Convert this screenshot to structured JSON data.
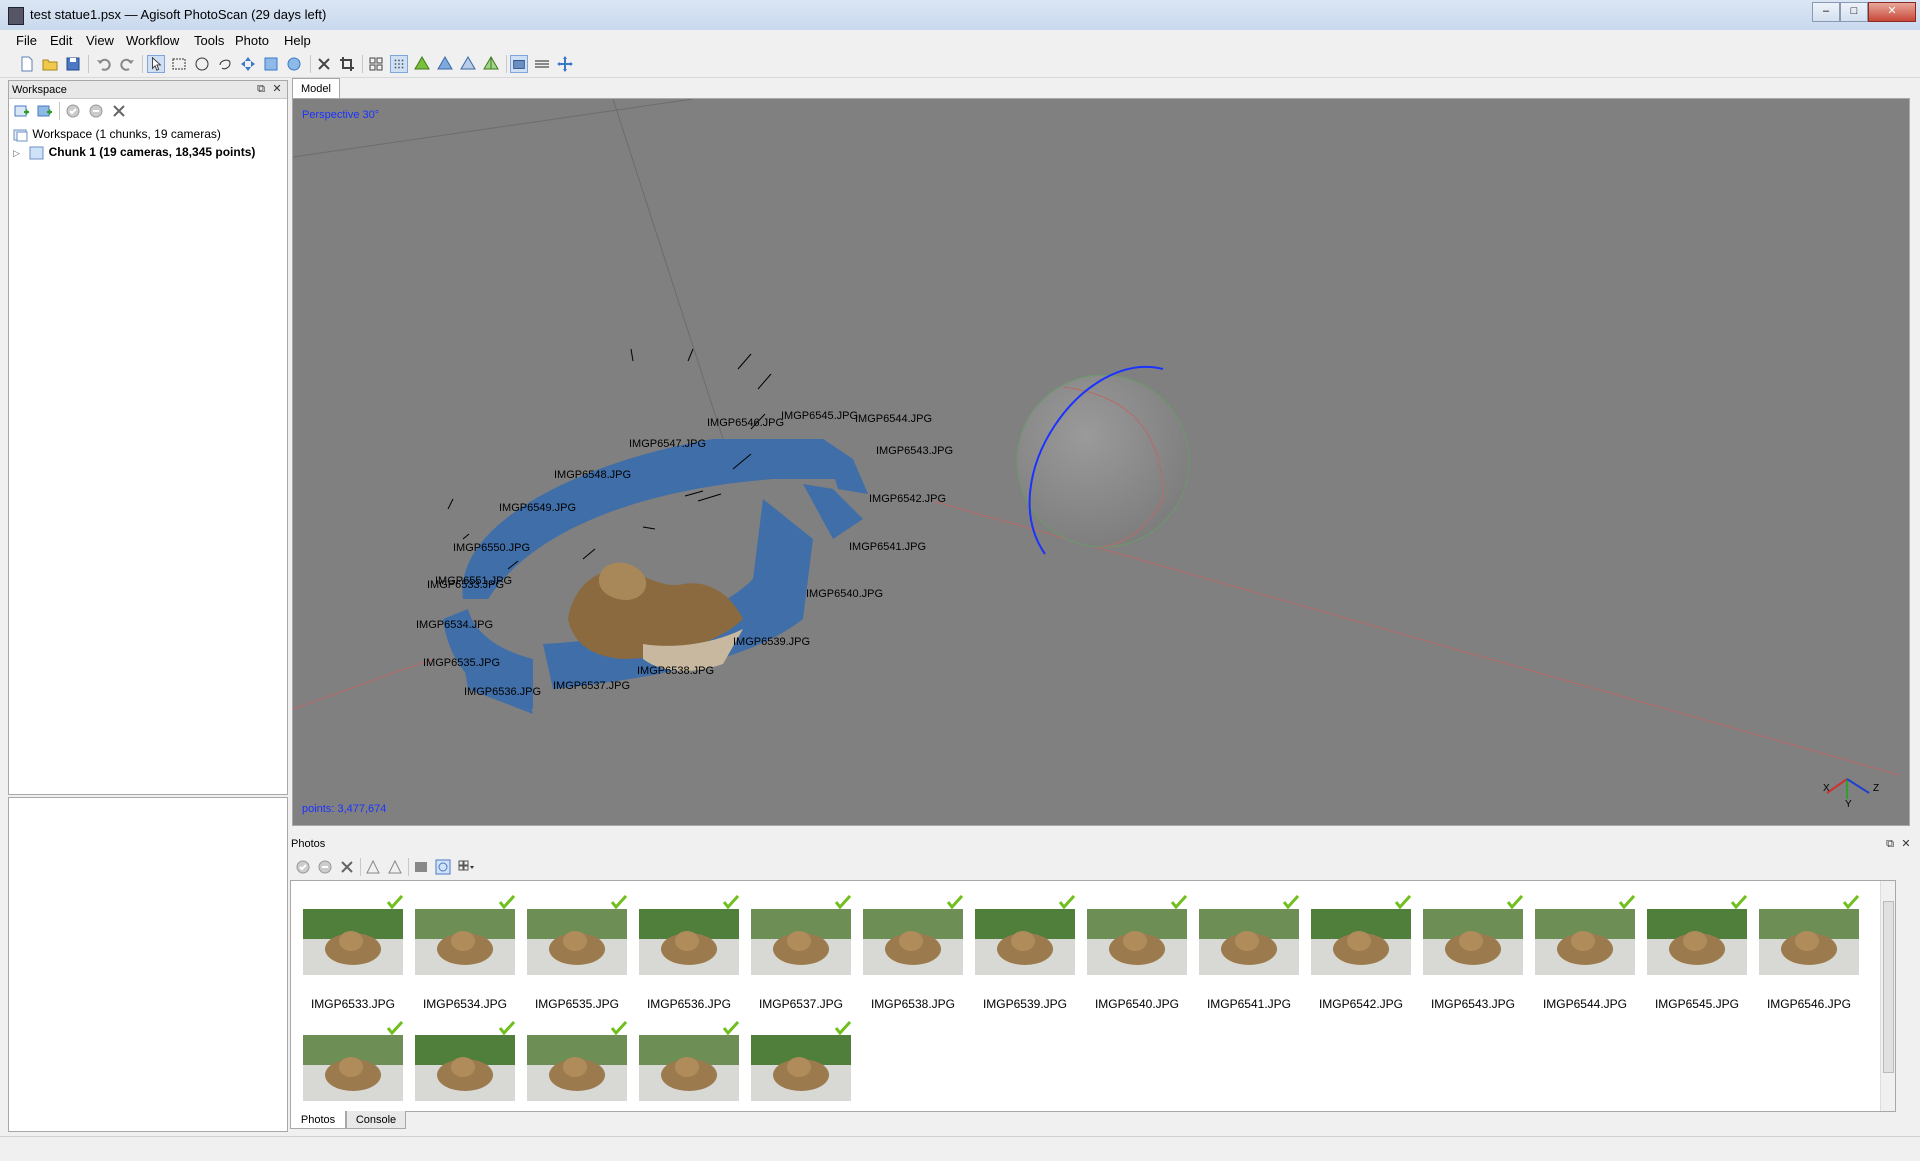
{
  "window": {
    "title": "test statue1.psx — Agisoft PhotoScan (29 days left)"
  },
  "menu": [
    "File",
    "Edit",
    "View",
    "Workflow",
    "Tools",
    "Photo",
    "Help"
  ],
  "workspace": {
    "title": "Workspace",
    "root": "Workspace (1 chunks, 19 cameras)",
    "chunk": "Chunk 1 (19 cameras, 18,345 points)"
  },
  "model": {
    "tab": "Model",
    "projection": "Perspective 30°",
    "points": "points: 3,477,674",
    "axes": {
      "x": "X",
      "y": "Y",
      "z": "Z"
    },
    "camera_labels": [
      "IMGP6546.JPG",
      "IMGP6545.JPG",
      "IMGP6544.JPG",
      "IMGP6543.JPG",
      "IMGP6542.JPG",
      "IMGP6541.JPG",
      "IMGP6540.JPG",
      "IMGP6539.JPG",
      "IMGP6538.JPG",
      "IMGP6537.JPG",
      "IMGP6536.JPG",
      "IMGP6535.JPG",
      "IMGP6534.JPG",
      "IMGP6547.JPG",
      "IMGP6548.JPG",
      "IMGP6549.JPG",
      "IMGP6550.JPG",
      "IMGP6551.JPG",
      "IMGP6533.JPG"
    ]
  },
  "photos": {
    "title": "Photos",
    "items": [
      "IMGP6533.JPG",
      "IMGP6534.JPG",
      "IMGP6535.JPG",
      "IMGP6536.JPG",
      "IMGP6537.JPG",
      "IMGP6538.JPG",
      "IMGP6539.JPG",
      "IMGP6540.JPG",
      "IMGP6541.JPG",
      "IMGP6542.JPG",
      "IMGP6543.JPG",
      "IMGP6544.JPG",
      "IMGP6545.JPG",
      "IMGP6546.JPG",
      "",
      "",
      "",
      "",
      ""
    ],
    "tabs": [
      "Photos",
      "Console"
    ]
  },
  "colors": {
    "viewport_bg": "#808080",
    "camera_blue": "#3f6ea8",
    "accent_text": "#1a33ff",
    "check_green": "#6fbf1f"
  }
}
